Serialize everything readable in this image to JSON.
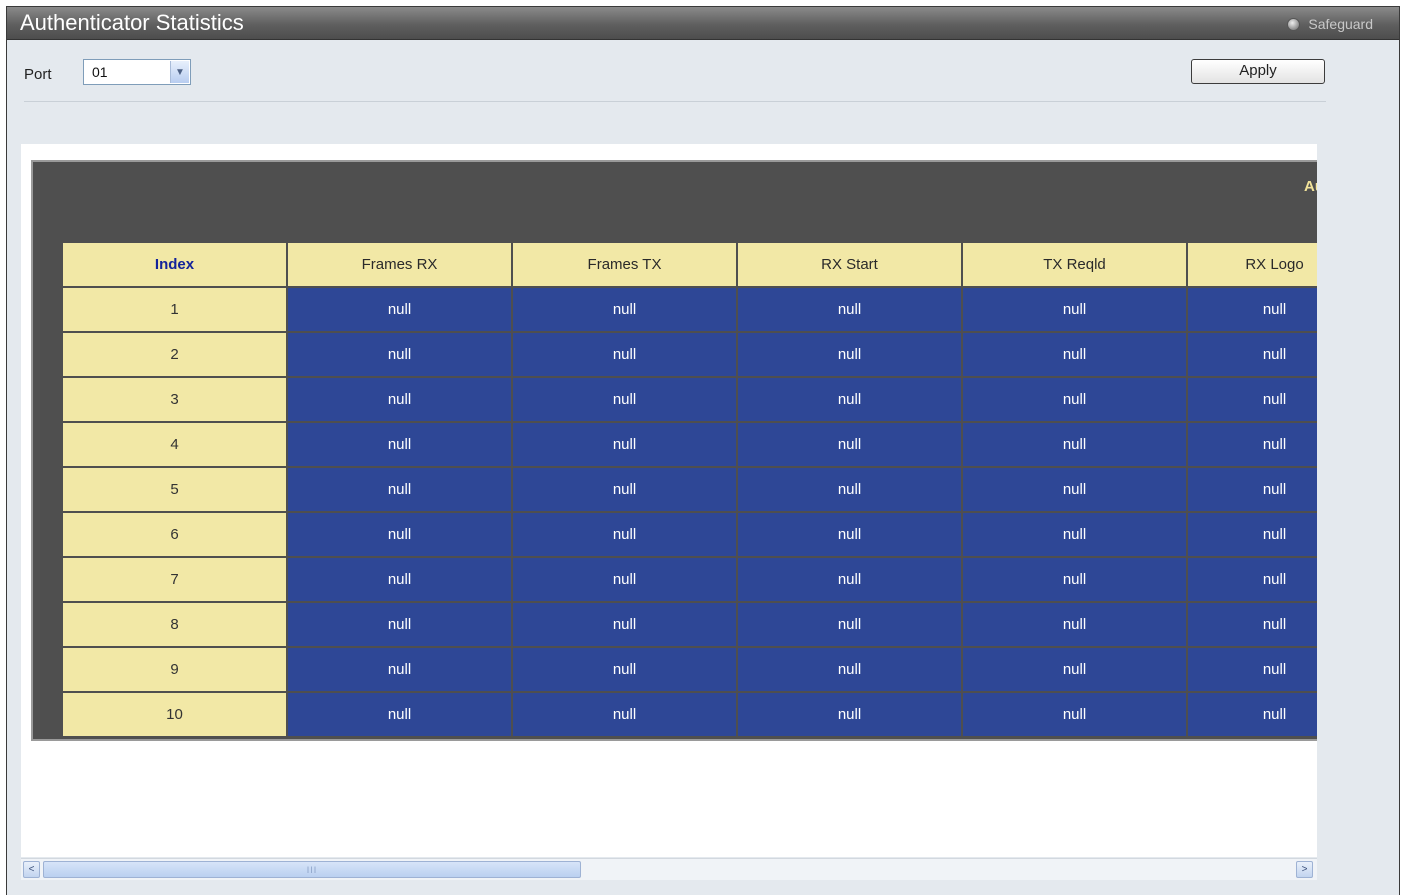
{
  "window": {
    "title": "Authenticator Statistics",
    "badge": "Safeguard",
    "badge_icon": "safeguard-indicator-icon"
  },
  "controls": {
    "port_label": "Port",
    "port_value": "01",
    "apply_label": "Apply"
  },
  "table": {
    "caption": "Au",
    "columns": [
      "Index",
      "Frames RX",
      "Frames TX",
      "RX Start",
      "TX Reqld",
      "RX Logo"
    ],
    "rows": [
      {
        "index": "1",
        "values": [
          "null",
          "null",
          "null",
          "null",
          "null"
        ]
      },
      {
        "index": "2",
        "values": [
          "null",
          "null",
          "null",
          "null",
          "null"
        ]
      },
      {
        "index": "3",
        "values": [
          "null",
          "null",
          "null",
          "null",
          "null"
        ]
      },
      {
        "index": "4",
        "values": [
          "null",
          "null",
          "null",
          "null",
          "null"
        ]
      },
      {
        "index": "5",
        "values": [
          "null",
          "null",
          "null",
          "null",
          "null"
        ]
      },
      {
        "index": "6",
        "values": [
          "null",
          "null",
          "null",
          "null",
          "null"
        ]
      },
      {
        "index": "7",
        "values": [
          "null",
          "null",
          "null",
          "null",
          "null"
        ]
      },
      {
        "index": "8",
        "values": [
          "null",
          "null",
          "null",
          "null",
          "null"
        ]
      },
      {
        "index": "9",
        "values": [
          "null",
          "null",
          "null",
          "null",
          "null"
        ]
      },
      {
        "index": "10",
        "values": [
          "null",
          "null",
          "null",
          "null",
          "null"
        ]
      }
    ]
  },
  "scrollbar": {
    "left_arrow": "<",
    "right_arrow": ">",
    "thumb_grip": "III"
  },
  "colors": {
    "header_cell": "#f2e8a6",
    "value_cell": "#2e4796",
    "table_frame": "#4f4f4f",
    "index_header_text": "#13239a"
  }
}
